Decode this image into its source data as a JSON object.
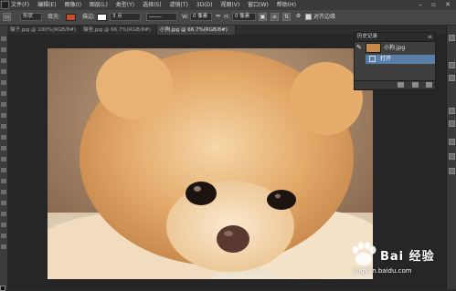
{
  "menubar": {
    "items": [
      "文件(F)",
      "编辑(E)",
      "图像(I)",
      "图层(L)",
      "类型(Y)",
      "选择(S)",
      "滤镜(T)",
      "3D(D)",
      "视图(V)",
      "窗口(W)",
      "帮助(H)"
    ],
    "window_controls": "– ▫ ✕"
  },
  "options": {
    "shape_mode": "形状",
    "fill_label": "填充:",
    "fill_color": "#c0502a",
    "stroke_label": "描边:",
    "stroke_size": "3 点",
    "w_label": "W:",
    "w_value": "0 像素",
    "h_label": "H:",
    "h_value": "0 像素",
    "align_edges": "对齐边缘"
  },
  "tabs": [
    {
      "label": "猫子.jpg @ 100%(RGB/8#)",
      "active": false
    },
    {
      "label": "猫爸.jpg @ 66.7%(RGB/8#)",
      "active": false
    },
    {
      "label": "小狗.jpg @ 66.7%(RGB/8#)",
      "active": true
    }
  ],
  "history": {
    "title": "历史记录",
    "snapshot_name": "小狗.jpg",
    "state_name": "打开"
  },
  "watermark": {
    "logo_text": "Bai 经验",
    "url": "jingyan.baidu.com"
  }
}
